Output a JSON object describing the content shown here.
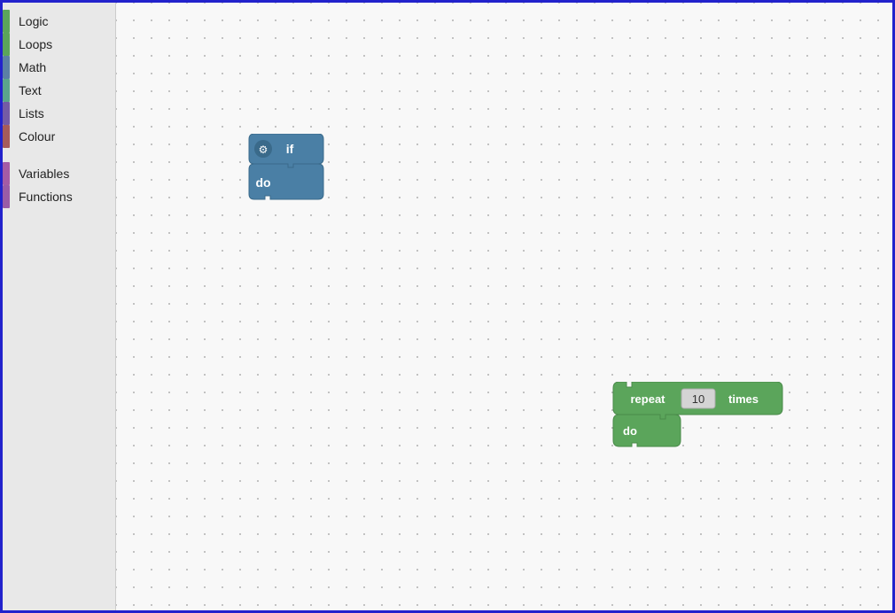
{
  "sidebar": {
    "items": [
      {
        "label": "Logic",
        "color": "#5ba55b",
        "id": "logic"
      },
      {
        "label": "Loops",
        "color": "#5ba55b",
        "id": "loops"
      },
      {
        "label": "Math",
        "color": "#5b80a5",
        "id": "math"
      },
      {
        "label": "Text",
        "color": "#5ba58c",
        "id": "text"
      },
      {
        "label": "Lists",
        "color": "#745ba5",
        "id": "lists"
      },
      {
        "label": "Colour",
        "color": "#a55b5b",
        "id": "colour"
      },
      {
        "label": "Variables",
        "color": "#a55ba5",
        "id": "variables"
      },
      {
        "label": "Functions",
        "color": "#9a5ca6",
        "id": "functions"
      }
    ]
  },
  "blocks": {
    "if_block": {
      "top_label": "if",
      "bottom_label": "do",
      "color": "#4a7fa5"
    },
    "repeat_block": {
      "top_label1": "repeat",
      "top_label2": "times",
      "bottom_label": "do",
      "value": "10",
      "color": "#5ba55b",
      "value_bg": "#ffffff"
    }
  }
}
